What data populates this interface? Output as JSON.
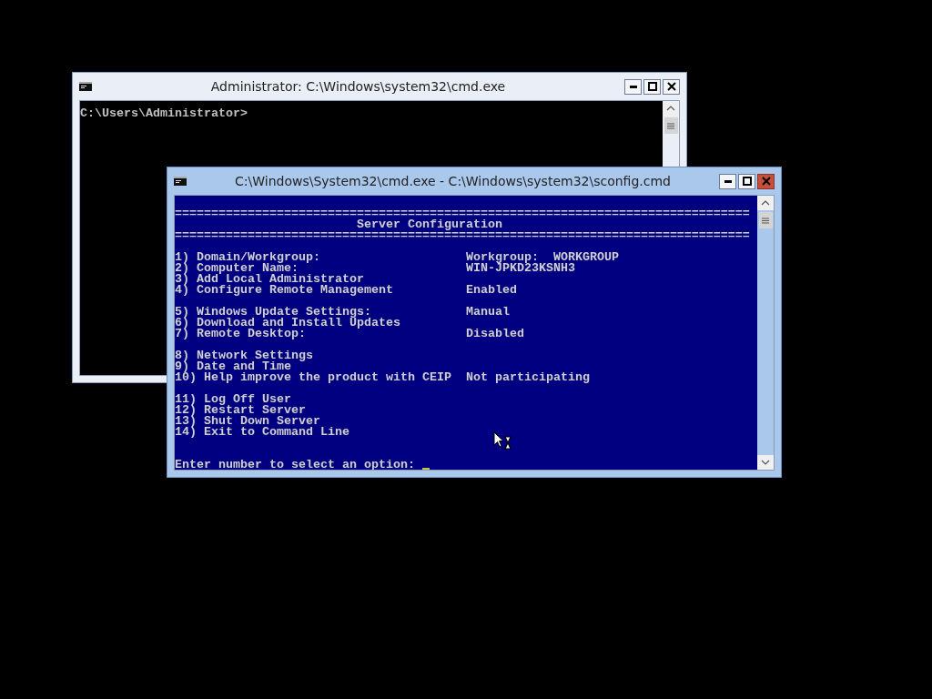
{
  "windows": [
    {
      "title": "Administrator: C:\\Windows\\system32\\cmd.exe",
      "active": false,
      "kind": "shell",
      "lines": [
        {
          "kind": "plain",
          "text": "C:\\Users\\Administrator>"
        }
      ]
    },
    {
      "title": "C:\\Windows\\System32\\cmd.exe - C:\\Windows\\system32\\sconfig.cmd",
      "active": true,
      "kind": "menu",
      "lines": [
        {
          "kind": "rule",
          "text": "==============================================================================="
        },
        {
          "kind": "heading",
          "text": "Server Configuration"
        },
        {
          "kind": "rule",
          "text": "==============================================================================="
        },
        {
          "kind": "blank"
        },
        {
          "kind": "option",
          "label": "1) Domain/Workgroup:",
          "value": "Workgroup:  WORKGROUP"
        },
        {
          "kind": "option",
          "label": "2) Computer Name:",
          "value": "WIN-JPKD23KSNH3"
        },
        {
          "kind": "option",
          "label": "3) Add Local Administrator"
        },
        {
          "kind": "option",
          "label": "4) Configure Remote Management",
          "value": "Enabled"
        },
        {
          "kind": "blank"
        },
        {
          "kind": "option",
          "label": "5) Windows Update Settings:",
          "value": "Manual"
        },
        {
          "kind": "option",
          "label": "6) Download and Install Updates"
        },
        {
          "kind": "option",
          "label": "7) Remote Desktop:",
          "value": "Disabled"
        },
        {
          "kind": "blank"
        },
        {
          "kind": "option",
          "label": "8) Network Settings"
        },
        {
          "kind": "option",
          "label": "9) Date and Time"
        },
        {
          "kind": "option",
          "label": "10) Help improve the product with CEIP",
          "value": "Not participating"
        },
        {
          "kind": "blank"
        },
        {
          "kind": "option",
          "label": "11) Log Off User"
        },
        {
          "kind": "option",
          "label": "12) Restart Server"
        },
        {
          "kind": "option",
          "label": "13) Shut Down Server"
        },
        {
          "kind": "option",
          "label": "14) Exit to Command Line"
        },
        {
          "kind": "blank"
        },
        {
          "kind": "blank"
        },
        {
          "kind": "prompt",
          "text": "Enter number to select an option:"
        }
      ]
    }
  ]
}
